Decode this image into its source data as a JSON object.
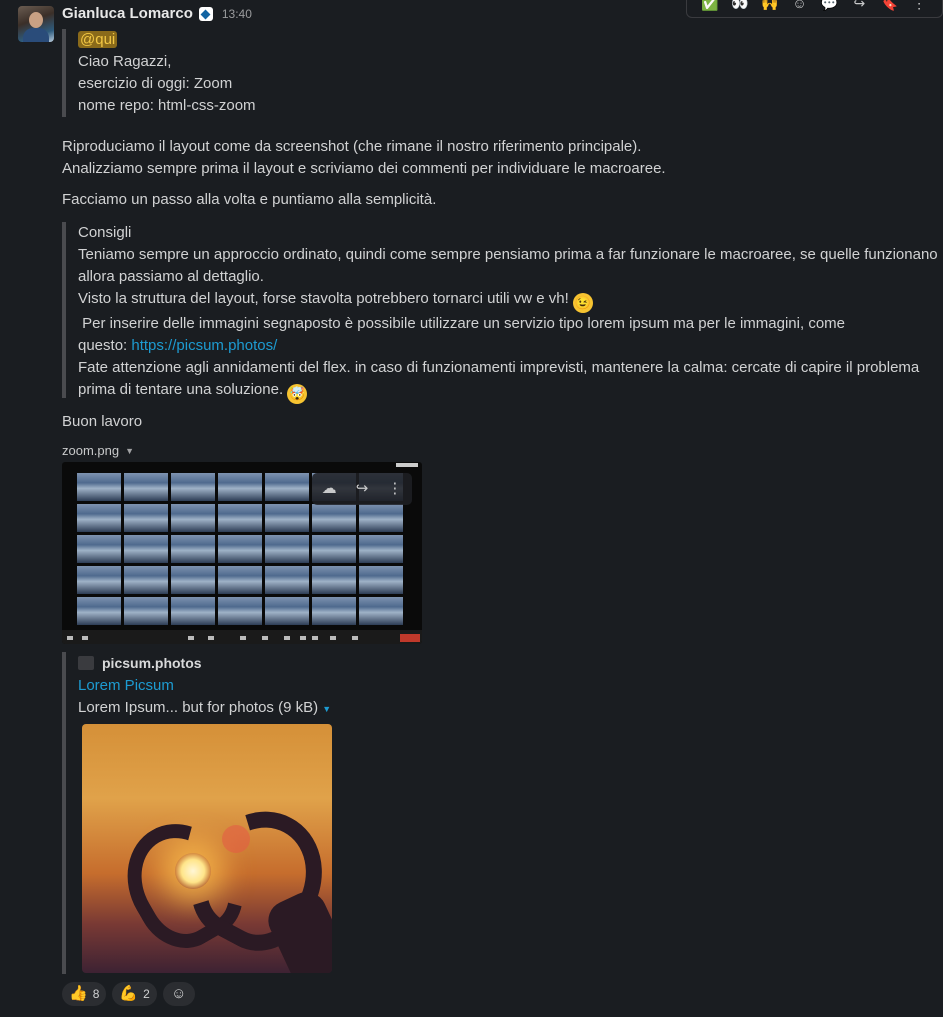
{
  "message": {
    "author": "Gianluca Lomarco",
    "time": "13:40",
    "quote1": {
      "mention": "@qui",
      "lines": [
        "Ciao Ragazzi,",
        "esercizio di oggi: Zoom",
        "nome repo: html-css-zoom"
      ]
    },
    "para1": [
      "Riproduciamo il layout come da screenshot (che rimane il nostro riferimento principale).",
      "Analizziamo sempre prima il layout e scriviamo dei commenti per individuare le macroaree."
    ],
    "para2": "Facciamo un passo alla volta e puntiamo alla semplicità.",
    "quote2": {
      "title": "Consigli",
      "l1": "Teniamo sempre un approccio ordinato, quindi come sempre pensiamo prima a far funzionare le macroaree, se quelle funzionano",
      "l2": "allora passiamo al dettaglio.",
      "l3": "Visto la struttura del layout, forse stavolta potrebbero tornarci utili vw e vh!",
      "l4": " Per inserire delle immagini segnaposto è possibile utilizzare un servizio tipo lorem ipsum ma per le immagini, come",
      "l5_prefix": "questo: ",
      "l5_link": "https://picsum.photos/",
      "l6": "Fate attenzione agli annidamenti del flex. in caso di funzionamenti imprevisti, mantenere la calma: cercate di capire il problema",
      "l7": "prima di tentare una soluzione."
    },
    "closing": "Buon lavoro",
    "file_name": "zoom.png",
    "unfurl": {
      "site": "picsum.photos",
      "title": "Lorem Picsum",
      "description": "Lorem Ipsum... but for photos (9 kB)"
    },
    "reactions": [
      {
        "emoji": "👍",
        "count": "8"
      },
      {
        "emoji": "💪",
        "count": "2"
      }
    ]
  },
  "icons": {
    "hover_bar": [
      "check-emoji-icon",
      "eyes-emoji-icon",
      "raised-hands-emoji-icon",
      "emoji-reaction-icon",
      "reply-thread-icon",
      "forward-icon",
      "bookmark-icon",
      "more-actions-icon"
    ],
    "image_actions": [
      "download-cloud-icon",
      "share-icon",
      "more-icon"
    ]
  },
  "colors": {
    "background": "#1a1d21",
    "link": "#1d9bd1",
    "mention_bg": "#8a6a1a",
    "mention_text": "#f2c744"
  }
}
